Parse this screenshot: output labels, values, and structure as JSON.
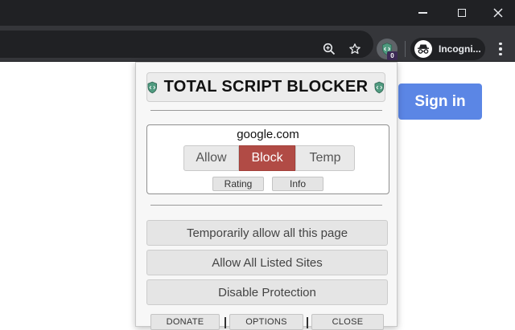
{
  "browser": {
    "profile_label": "Incogni...",
    "extension_badge": "0",
    "icons": {
      "zoom": "zoom-magnifier-icon",
      "bookmark": "star-icon",
      "extension": "shield-code-icon",
      "profile": "incognito-icon",
      "menu": "kebab-menu-icon"
    }
  },
  "page": {
    "signin_label": "Sign in",
    "signin_color": "#5b86e5"
  },
  "popup": {
    "title": "TOTAL SCRIPT BLOCKER",
    "domain": "google.com",
    "mode_options": [
      "Allow",
      "Block",
      "Temp"
    ],
    "selected_mode": "Block",
    "block_color": "#b14b45",
    "rating_label": "Rating",
    "info_label": "Info",
    "actions": [
      "Temporarily allow all this page",
      "Allow All Listed Sites",
      "Disable Protection"
    ],
    "footer": [
      "DONATE",
      "OPTIONS",
      "CLOSE"
    ]
  }
}
